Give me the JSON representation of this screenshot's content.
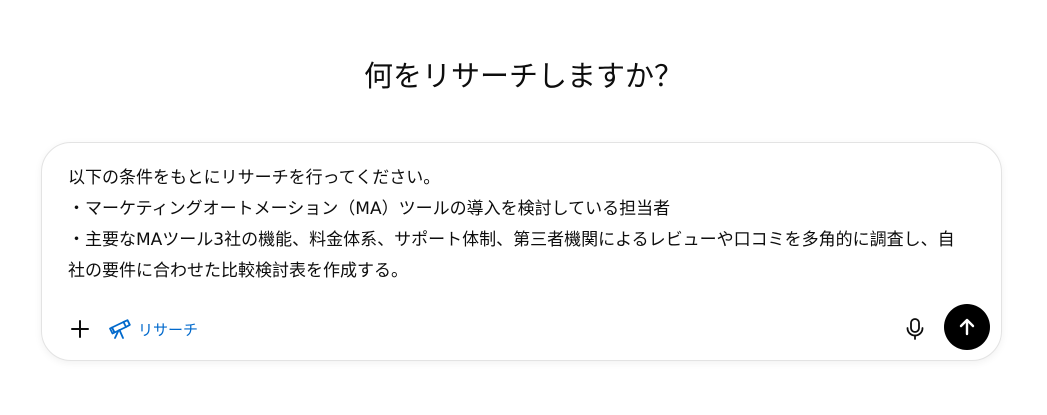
{
  "heading": "何をリサーチしますか？",
  "composer": {
    "prompt_lines": [
      "以下の条件をもとにリサーチを行ってください。",
      "・マーケティングオートメーション（MA）ツールの導入を検討している担当者",
      "・主要なMAツール3社の機能、料金体系、サポート体制、第三者機関によるレビューや口コミを多角的に調査し、自",
      "社の要件に合わせた比較検討表を作成する。"
    ],
    "add_icon": "plus-icon",
    "research_tool": {
      "icon": "telescope-icon",
      "label": "リサーチ"
    },
    "mic_icon": "microphone-icon",
    "send_icon": "arrow-up-icon"
  },
  "colors": {
    "accent": "#0169cc",
    "send_button": "#000000",
    "text": "#0d0d0d",
    "border": "#e3e3e3"
  }
}
